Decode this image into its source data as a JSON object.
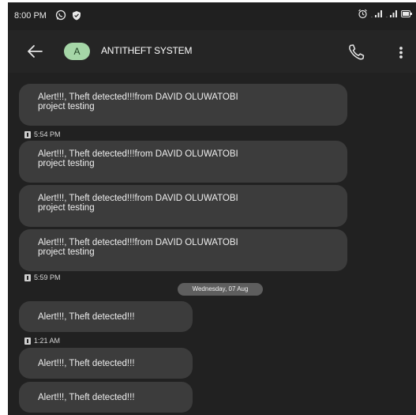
{
  "status_bar": {
    "time": "8:00 PM",
    "icons": [
      "whatsapp-icon",
      "shield-icon",
      "alarm-icon",
      "signal-icon",
      "signal-icon",
      "battery-icon"
    ]
  },
  "header": {
    "avatar_initial": "A",
    "title": "ANTITHEFT SYSTEM",
    "icons": [
      "back-arrow-icon",
      "phone-icon",
      "more-vert-icon"
    ]
  },
  "messages": [
    {
      "text_line1": "Alert!!!, Theft detected!!!from DAVID OLUWATOBI",
      "text_line2": "project testing"
    },
    {
      "timestamp": "5:54 PM"
    },
    {
      "text_line1": "Alert!!!, Theft detected!!!from DAVID OLUWATOBI",
      "text_line2": "project testing"
    },
    {
      "text_line1": "Alert!!!, Theft detected!!!from DAVID OLUWATOBI",
      "text_line2": "project testing"
    },
    {
      "text_line1": "Alert!!!, Theft detected!!!from DAVID OLUWATOBI",
      "text_line2": "project testing"
    },
    {
      "timestamp": "5:59 PM"
    },
    {
      "date_separator": "Wednesday, 07 Aug"
    },
    {
      "text": "Alert!!!, Theft detected!!!"
    },
    {
      "timestamp": "1:21 AM"
    },
    {
      "text": "Alert!!!, Theft detected!!!"
    },
    {
      "text": "Alert!!!, Theft detected!!!"
    }
  ],
  "colors": {
    "background": "#212121",
    "bubble": "#3c3c3c",
    "avatar": "#a5d6a7",
    "date_chip": "#5e5e5e"
  }
}
